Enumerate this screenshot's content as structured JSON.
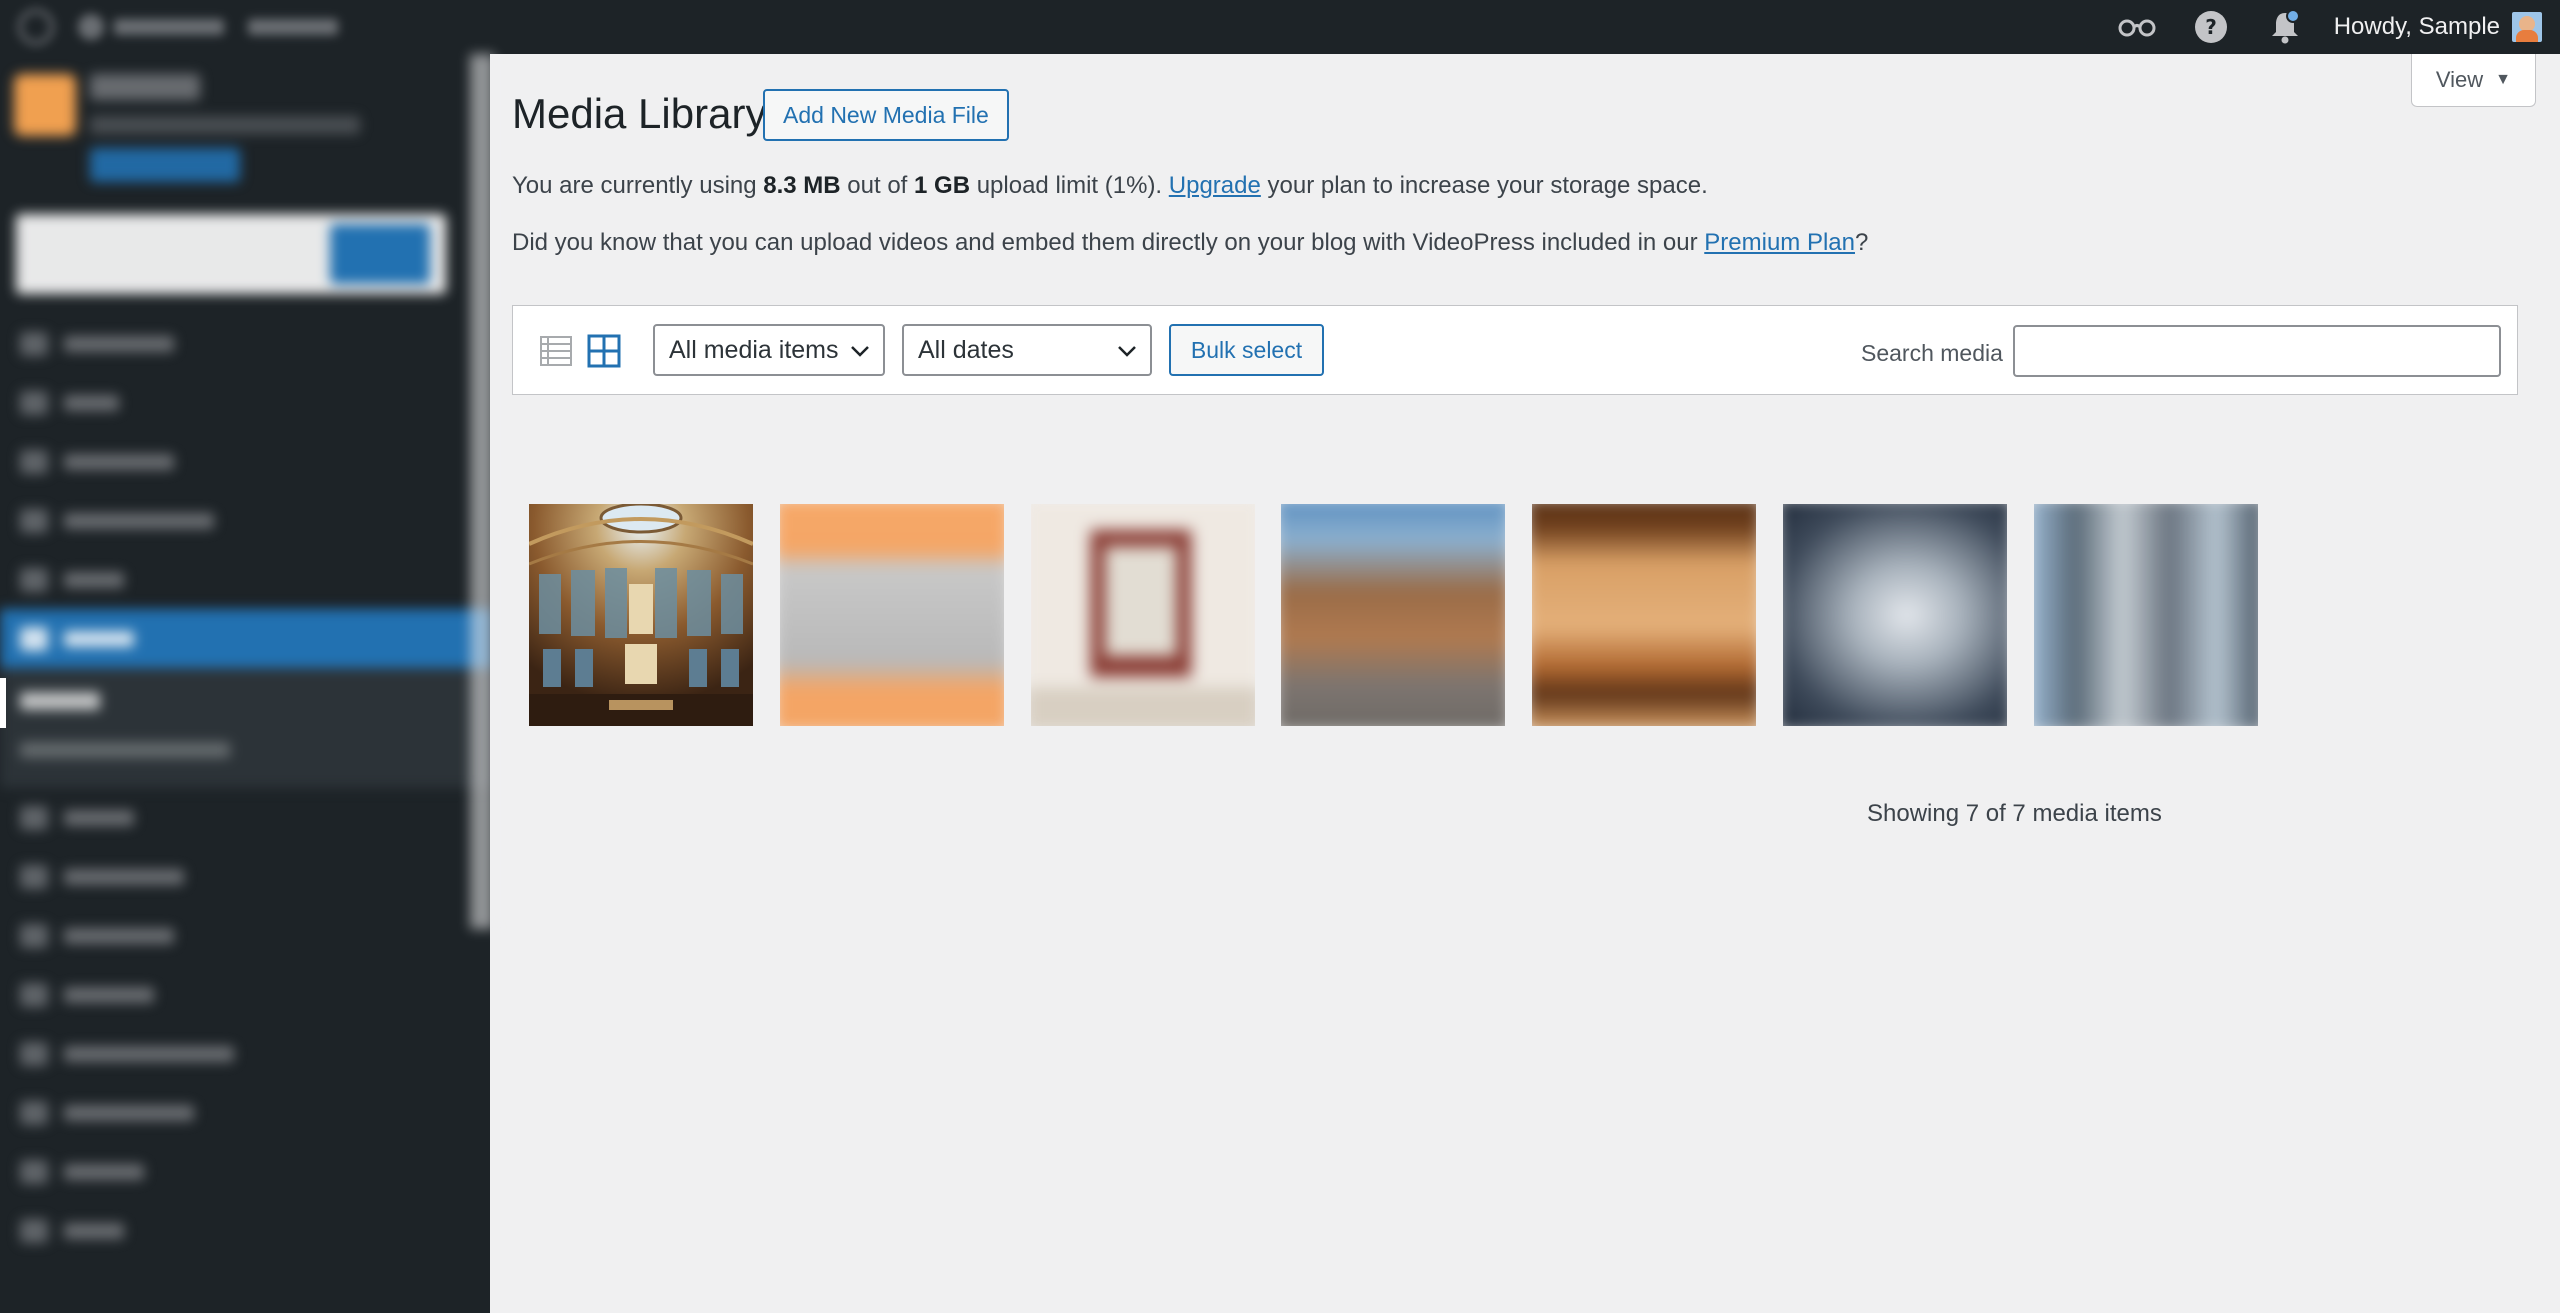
{
  "adminbar": {
    "greeting": "Howdy, Sample",
    "icons": [
      "reader-icon",
      "help-icon",
      "notifications-icon"
    ]
  },
  "page": {
    "title": "Media Library",
    "add_new_label": "Add New Media File",
    "view_label": "View",
    "view_caret": "▼"
  },
  "notices": {
    "storage": {
      "pre": "You are currently using ",
      "used": "8.3 MB",
      "mid": " out of ",
      "limit": "1 GB",
      "post": " upload limit (1%). ",
      "link": "Upgrade",
      "tail": " your plan to increase your storage space."
    },
    "video": {
      "pre": "Did you know that you can upload videos and embed them directly on your blog with VideoPress included in our ",
      "link": "Premium Plan",
      "tail": "?"
    }
  },
  "toolbar": {
    "type_filter": "All media items",
    "date_filter": "All dates",
    "bulk_label": "Bulk select",
    "search_label": "Search media",
    "search_value": ""
  },
  "media": {
    "item_count": 7,
    "count_text": "Showing 7 of 7 media items"
  },
  "colors": {
    "accent": "#2271b1",
    "adminbar_bg": "#1d2327",
    "page_bg": "#f0f0f1"
  }
}
